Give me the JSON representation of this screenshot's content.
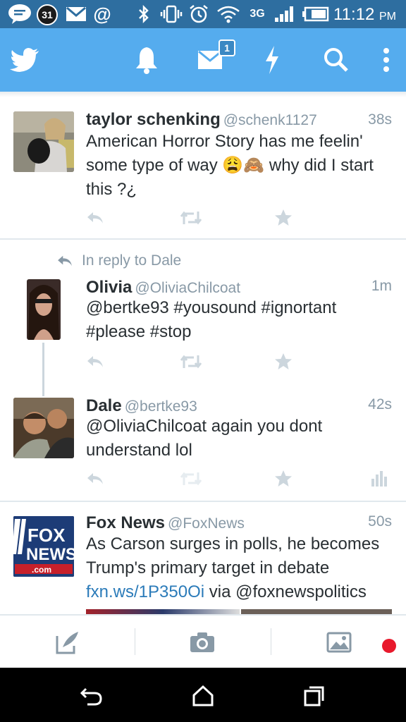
{
  "status_bar": {
    "calendar_day": "31",
    "network": "3G",
    "time": "11:12",
    "ampm": "PM"
  },
  "app_bar": {
    "dm_badge_count": "1",
    "accent_color": "#55acee"
  },
  "tweets": [
    {
      "name": "taylor schenking",
      "handle": "@schenk1127",
      "time": "38s",
      "text_before": "American Horror Story has me feelin' some type of way ",
      "emoji": "😩🙈",
      "text_after": " why did I start this ?¿"
    },
    {
      "reply_context": "In reply to Dale",
      "name": "Olivia",
      "handle": "@OliviaChilcoat",
      "time": "1m",
      "text": "@bertke93 #yousound #ignortant #please #stop"
    },
    {
      "name": "Dale",
      "handle": "@bertke93",
      "time": "42s",
      "text": "@OliviaChilcoat again you dont understand lol"
    },
    {
      "name": "Fox News",
      "handle": "@FoxNews",
      "time": "50s",
      "text": "As Carson surges in polls, he becomes Trump's primary target in debate",
      "link": "fxn.ws/1P350Oi",
      "text_tail": " via @foxnewspolitics",
      "avatar_logo": {
        "line1": "FOX",
        "line2": "NEWS",
        "line3": ".com"
      }
    }
  ]
}
